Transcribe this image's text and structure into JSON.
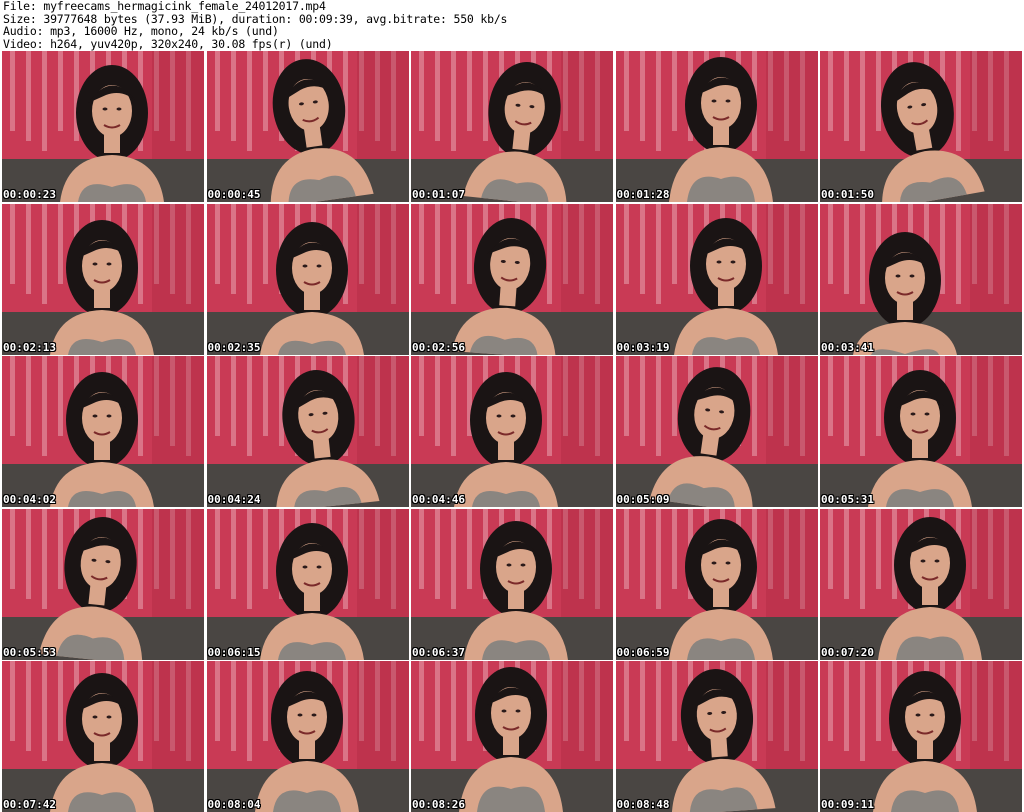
{
  "header": {
    "file_line": "File: myfreecams_hermagicink_female_24012017.mp4",
    "size_line": "Size: 39777648 bytes (37.93 MiB), duration: 00:09:39, avg.bitrate: 550 kb/s",
    "audio_line": "Audio: mp3, 16000 Hz, mono, 24 kb/s (und)",
    "video_line": "Video: h264, yuv420p, 320x240, 30.08 fps(r) (und)"
  },
  "thumbnails": [
    {
      "timestamp": "00:00:23"
    },
    {
      "timestamp": "00:00:45"
    },
    {
      "timestamp": "00:01:07"
    },
    {
      "timestamp": "00:01:28"
    },
    {
      "timestamp": "00:01:50"
    },
    {
      "timestamp": "00:02:13"
    },
    {
      "timestamp": "00:02:35"
    },
    {
      "timestamp": "00:02:56"
    },
    {
      "timestamp": "00:03:19"
    },
    {
      "timestamp": "00:03:41"
    },
    {
      "timestamp": "00:04:02"
    },
    {
      "timestamp": "00:04:24"
    },
    {
      "timestamp": "00:04:46"
    },
    {
      "timestamp": "00:05:09"
    },
    {
      "timestamp": "00:05:31"
    },
    {
      "timestamp": "00:05:53"
    },
    {
      "timestamp": "00:06:15"
    },
    {
      "timestamp": "00:06:37"
    },
    {
      "timestamp": "00:06:59"
    },
    {
      "timestamp": "00:07:20"
    },
    {
      "timestamp": "00:07:42"
    },
    {
      "timestamp": "00:08:04"
    },
    {
      "timestamp": "00:08:26"
    },
    {
      "timestamp": "00:08:48"
    },
    {
      "timestamp": "00:09:11"
    }
  ],
  "colors": {
    "backdrop": "#c93a55",
    "backdrop_dark": "#a8283f",
    "backdrop_stripe": "#e8a4b0",
    "couch": "#4a4643",
    "hair": "#1a1414",
    "skin": "#d9a58a",
    "top": "#8a8580"
  }
}
